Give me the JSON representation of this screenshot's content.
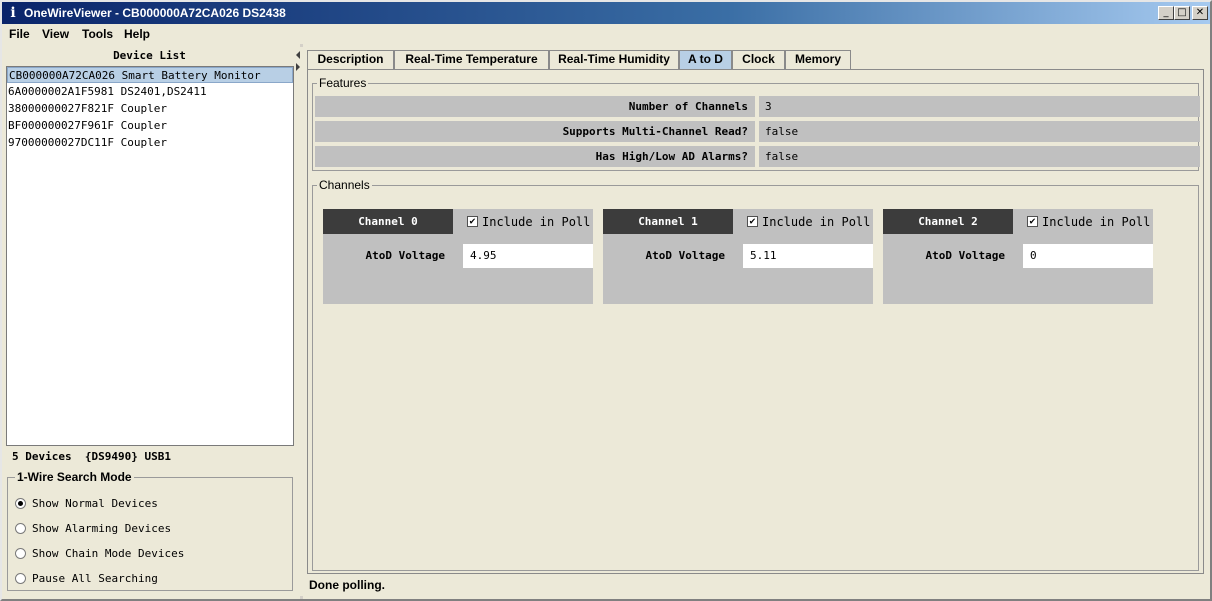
{
  "window": {
    "title": "OneWireViewer - CB000000A72CA026 DS2438",
    "app_icon_glyph": "i",
    "minimize_glyph": "_",
    "maximize_glyph": "□",
    "close_glyph": "✕"
  },
  "menu": [
    "File",
    "View",
    "Tools",
    "Help"
  ],
  "device_list": {
    "title": "Device List",
    "items": [
      "CB000000A72CA026 Smart Battery Monitor",
      "6A0000002A1F5981 DS2401,DS2411",
      "38000000027F821F Coupler",
      "BF000000027F961F Coupler",
      "97000000027DC11F Coupler"
    ],
    "selected_index": 0,
    "status": "5 Devices  {DS9490} USB1"
  },
  "search_mode": {
    "title": "1-Wire Search Mode",
    "options": [
      "Show Normal Devices",
      "Show Alarming Devices",
      "Show Chain Mode Devices",
      "Pause All Searching"
    ],
    "selected_index": 0
  },
  "tabs": {
    "items": [
      "Description",
      "Real-Time Temperature",
      "Real-Time Humidity",
      "A to D",
      "Clock",
      "Memory"
    ],
    "active_index": 3
  },
  "features": {
    "title": "Features",
    "rows": [
      {
        "label": "Number of Channels",
        "value": "3"
      },
      {
        "label": "Supports Multi-Channel Read?",
        "value": "false"
      },
      {
        "label": "Has High/Low AD Alarms?",
        "value": "false"
      }
    ]
  },
  "channels": {
    "title": "Channels",
    "checkbox_label": "Include in Poll",
    "checkbox_glyph": "✔",
    "voltage_label": "AtoD Voltage",
    "items": [
      {
        "name": "Channel 0",
        "included": true,
        "voltage": "4.95"
      },
      {
        "name": "Channel 1",
        "included": true,
        "voltage": "5.11"
      },
      {
        "name": "Channel 2",
        "included": true,
        "voltage": "0"
      }
    ]
  },
  "status": "Done polling.",
  "colors": {
    "title_bar_start": "#0a246a",
    "selected_tab": "#b8cfe5",
    "channel_header": "#3c3c3c",
    "row_background": "#c0c0c0"
  }
}
